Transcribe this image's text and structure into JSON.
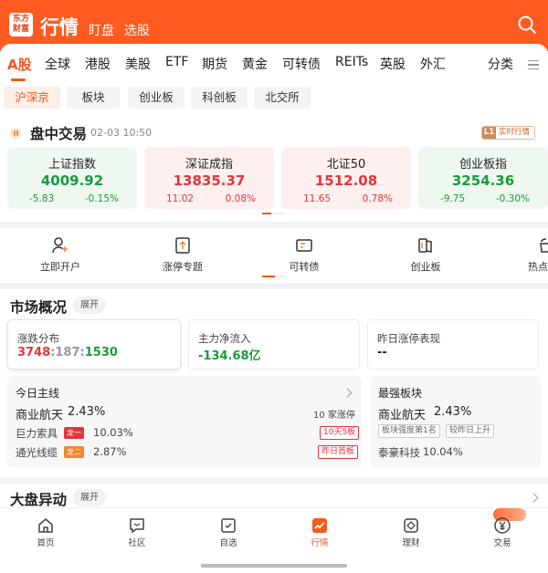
{
  "header": {
    "logo_text": "东方财富",
    "title": "行情",
    "tabs": [
      "盯盘",
      "选股"
    ],
    "search_icon": "search-icon",
    "brand_color": "#ff5a1f"
  },
  "market_tabs": [
    "A股",
    "全球",
    "港股",
    "美股",
    "ETF",
    "期货",
    "黄金",
    "可转债",
    "REITs",
    "英股",
    "外汇"
  ],
  "market_tab_active": "A股",
  "category_label": "分类",
  "sub_tabs": [
    "沪深京",
    "板块",
    "创业板",
    "科创板",
    "北交所"
  ],
  "intraday": {
    "title": "盘中交易",
    "time": "02-03 10:50",
    "badge_level": "L1",
    "badge_text": "实时行情"
  },
  "indices": [
    {
      "name": "上证指数",
      "value": "4009.92",
      "change": "-5.83",
      "pct": "-0.15%",
      "dir": "down"
    },
    {
      "name": "深证成指",
      "value": "13835.37",
      "change": "11.02",
      "pct": "0.08%",
      "dir": "up"
    },
    {
      "name": "北证50",
      "value": "1512.08",
      "change": "11.65",
      "pct": "0.78%",
      "dir": "up"
    },
    {
      "name": "创业板指",
      "value": "3254.36",
      "change": "-9.75",
      "pct": "-0.30%",
      "dir": "down"
    }
  ],
  "shortcuts": [
    {
      "label": "立即开户",
      "icon": "user-plus-icon"
    },
    {
      "label": "涨停专题",
      "icon": "limit-up-icon"
    },
    {
      "label": "可转债",
      "icon": "bond-ticket-icon"
    },
    {
      "label": "创业板",
      "icon": "book-icon"
    },
    {
      "label": "热点",
      "icon": "hot-bag-icon"
    }
  ],
  "market_overview": {
    "title": "市场概况",
    "expand": "展开",
    "distribution": {
      "label": "涨跌分布",
      "up": "3748",
      "sep1": ":",
      "flat": "187",
      "sep2": ":",
      "down": "1530"
    },
    "net_inflow": {
      "label": "主力净流入",
      "value": "-134.68亿"
    },
    "yesterday_limit": {
      "label": "昨日涨停表现",
      "value": "--"
    }
  },
  "main_line": {
    "title": "今日主线",
    "sector": "商业航天",
    "sector_pct": "2.43%",
    "limit_count": "10 家涨停",
    "stocks": [
      {
        "name": "巨力索具",
        "tag": "龙一",
        "pct": "10.03%",
        "note": "10天5板"
      },
      {
        "name": "通光线缆",
        "tag": "龙二",
        "pct": "2.87%",
        "note": "昨日首板"
      }
    ]
  },
  "strongest": {
    "title": "最强板块",
    "sector": "商业航天",
    "sector_pct": "2.43%",
    "tags": [
      "板块强度第1名",
      "较昨日上升"
    ],
    "stock": "泰豪科技",
    "stock_pct": "10.04%"
  },
  "dapan": {
    "title": "大盘异动",
    "expand": "展开"
  },
  "bottom_nav": [
    {
      "label": "首页",
      "icon": "home-icon"
    },
    {
      "label": "社区",
      "icon": "chat-icon"
    },
    {
      "label": "自选",
      "icon": "calendar-check-icon"
    },
    {
      "label": "行情",
      "icon": "chart-icon"
    },
    {
      "label": "理财",
      "icon": "diamond-icon"
    },
    {
      "label": "交易",
      "icon": "yuan-icon"
    }
  ],
  "bottom_nav_active": "行情",
  "colors": {
    "up": "#e3343c",
    "down": "#1a9a3c",
    "accent": "#f05a1f"
  }
}
